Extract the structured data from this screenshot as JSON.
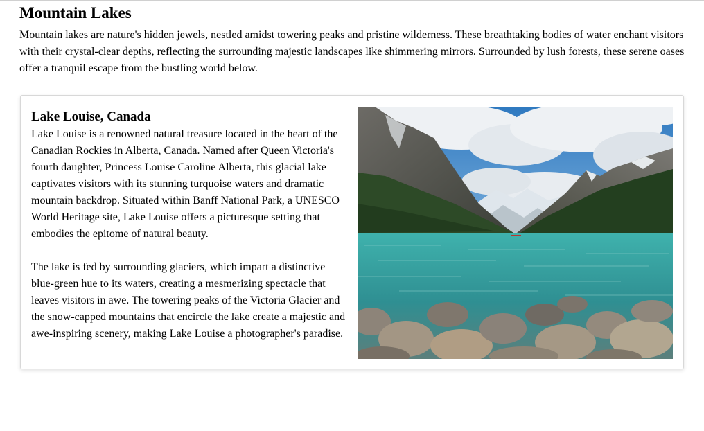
{
  "page": {
    "title": "Mountain Lakes",
    "intro": "Mountain lakes are nature's hidden jewels, nestled amidst towering peaks and pristine wilderness. These breathtaking bodies of water enchant visitors with their crystal-clear depths, reflecting the surrounding majestic landscapes like shimmering mirrors. Surrounded by lush forests, these serene oases offer a tranquil escape from the bustling world below."
  },
  "card": {
    "heading": "Lake Louise, Canada",
    "paragraphs": [
      "Lake Louise is a renowned natural treasure located in the heart of the Canadian Rockies in Alberta, Canada. Named after Queen Victoria's fourth daughter, Princess Louise Caroline Alberta, this glacial lake captivates visitors with its stunning turquoise waters and dramatic mountain backdrop. Situated within Banff National Park, a UNESCO World Heritage site, Lake Louise offers a picturesque setting that embodies the epitome of natural beauty.",
      "The lake is fed by surrounding glaciers, which impart a distinctive blue-green hue to its waters, creating a mesmerizing spectacle that leaves visitors in awe. The towering peaks of the Victoria Glacier and the snow-capped mountains that encircle the lake create a majestic and awe-inspiring scenery, making Lake Louise a photographer's paradise."
    ]
  },
  "colors": {
    "sky": "#3f86c8",
    "cloud": "#e9edf1",
    "forest": "#24401f",
    "lake": "#3aa6a2",
    "rock": "#8f8578"
  }
}
